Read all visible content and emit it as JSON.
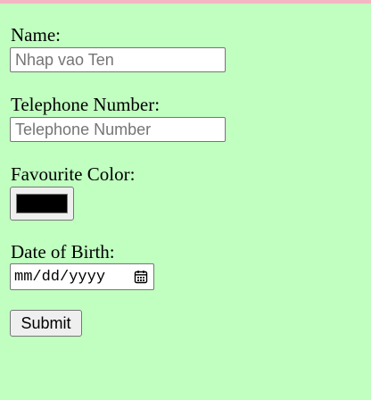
{
  "form": {
    "name": {
      "label": "Name:",
      "placeholder": "Nhap vao Ten",
      "value": ""
    },
    "phone": {
      "label": "Telephone Number:",
      "placeholder": "Telephone Number",
      "value": ""
    },
    "color": {
      "label": "Favourite Color:",
      "value": "#000000"
    },
    "dob": {
      "label": "Date of Birth:",
      "display": "mm/dd/yyyy",
      "icon": "calendar-icon"
    },
    "submit_label": "Submit"
  },
  "colors": {
    "background": "#c1ffc1",
    "top_border": "#f4b6c2"
  }
}
